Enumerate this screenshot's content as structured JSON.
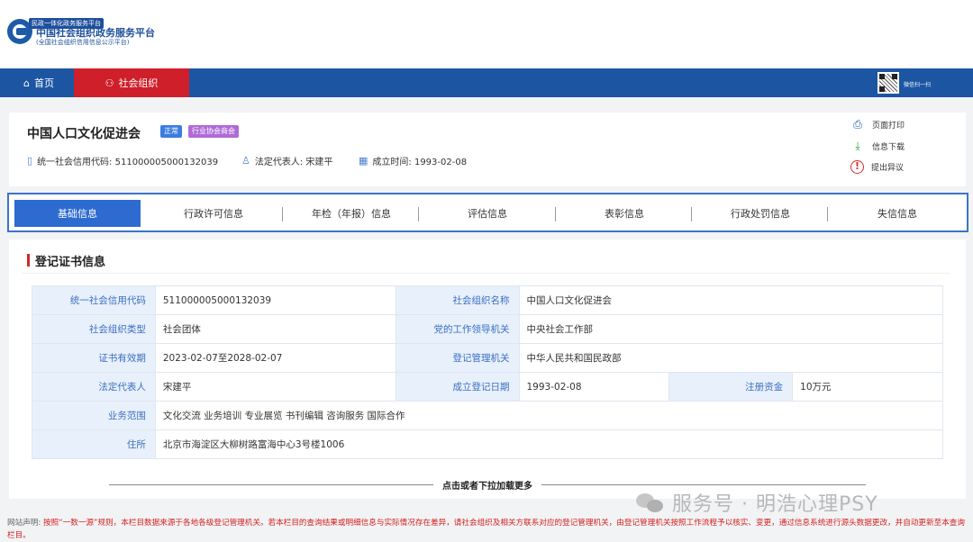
{
  "header": {
    "tag": "民政一体化政务服务平台",
    "title": "中国社会组织政务服务平台",
    "subtitle": "(全国社会组织信用信息公示平台)"
  },
  "nav": {
    "home": "首页",
    "org": "社会组织",
    "qr_label": "微信扫一扫"
  },
  "org": {
    "name": "中国人口文化促进会",
    "badge_status": "正常",
    "badge_type": "行业协会商会",
    "code_text": "统一社会信用代码: 511000005000132039",
    "rep_text": "法定代表人: 宋建平",
    "date_text": "成立时间: 1993-02-08"
  },
  "actions": {
    "print": "页面打印",
    "download": "信息下载",
    "object": "提出异议"
  },
  "tabs": [
    "基础信息",
    "行政许可信息",
    "年检（年报）信息",
    "评估信息",
    "表彰信息",
    "行政处罚信息",
    "失信信息"
  ],
  "section": {
    "title": "登记证书信息"
  },
  "info": {
    "code_label": "统一社会信用代码",
    "code_value": "511000005000132039",
    "name_label": "社会组织名称",
    "name_value": "中国人口文化促进会",
    "type_label": "社会组织类型",
    "type_value": "社会团体",
    "party_label": "党的工作领导机关",
    "party_value": "中央社会工作部",
    "validity_label": "证书有效期",
    "validity_value": "2023-02-07至2028-02-07",
    "registry_label": "登记管理机关",
    "registry_value": "中华人民共和国民政部",
    "rep_label": "法定代表人",
    "rep_value": "宋建平",
    "founded_label": "成立登记日期",
    "founded_value": "1993-02-08",
    "capital_label": "注册资金",
    "capital_value": "10万元",
    "scope_label": "业务范围",
    "scope_value": "文化交流 业务培训 专业展览 书刊编辑 咨询服务 国际合作",
    "address_label": "住所",
    "address_value": "北京市海淀区大柳树路富海中心3号楼1006"
  },
  "load_more": "点击或者下拉加载更多",
  "watermark": "服务号 · 明浩心理PSY",
  "footer": {
    "label": "网站声明:",
    "text": "按照“一数一源”规则，本栏目数据来源于各地各级登记管理机关。若本栏目的查询结果或明细信息与实际情况存在差异，请社会组织及相关方联系对应的登记管理机关，由登记管理机关按照工作流程予以核实、变更，通过信息系统进行源头数据更改，并自动更新至本查询栏目。"
  }
}
